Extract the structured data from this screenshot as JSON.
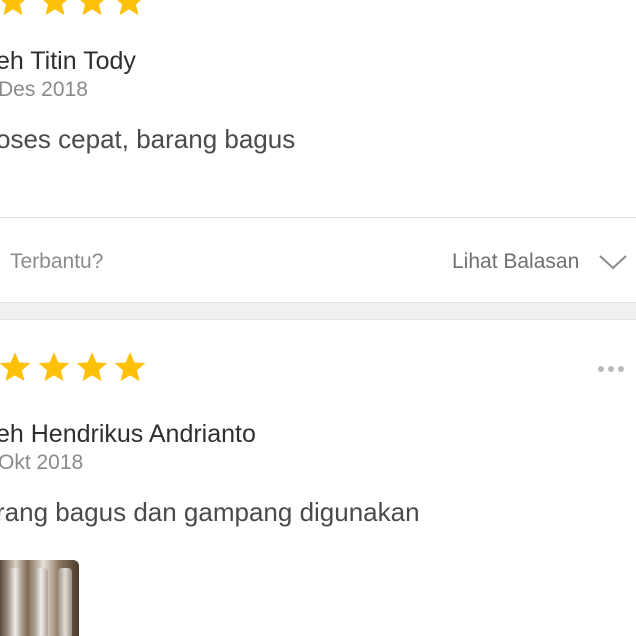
{
  "review1": {
    "rating": 5,
    "author": "eh Titin Tody",
    "date": "Des 2018",
    "text": "oses cepat, barang bagus",
    "helpful_label": "Terbantu?",
    "view_replies_label": "Lihat Balasan"
  },
  "review2": {
    "rating": 5,
    "author": "eh Hendrikus Andrianto",
    "date": "Okt 2018",
    "text": "rang bagus dan gampang digunakan",
    "has_photo": true
  },
  "colors": {
    "star": "#FFC107",
    "divider": "#DCDCDC",
    "section_gap": "#F0F0F0"
  },
  "icons": {
    "star": "star-icon",
    "chevron": "chevron-down-icon",
    "more": "more-options-icon"
  }
}
